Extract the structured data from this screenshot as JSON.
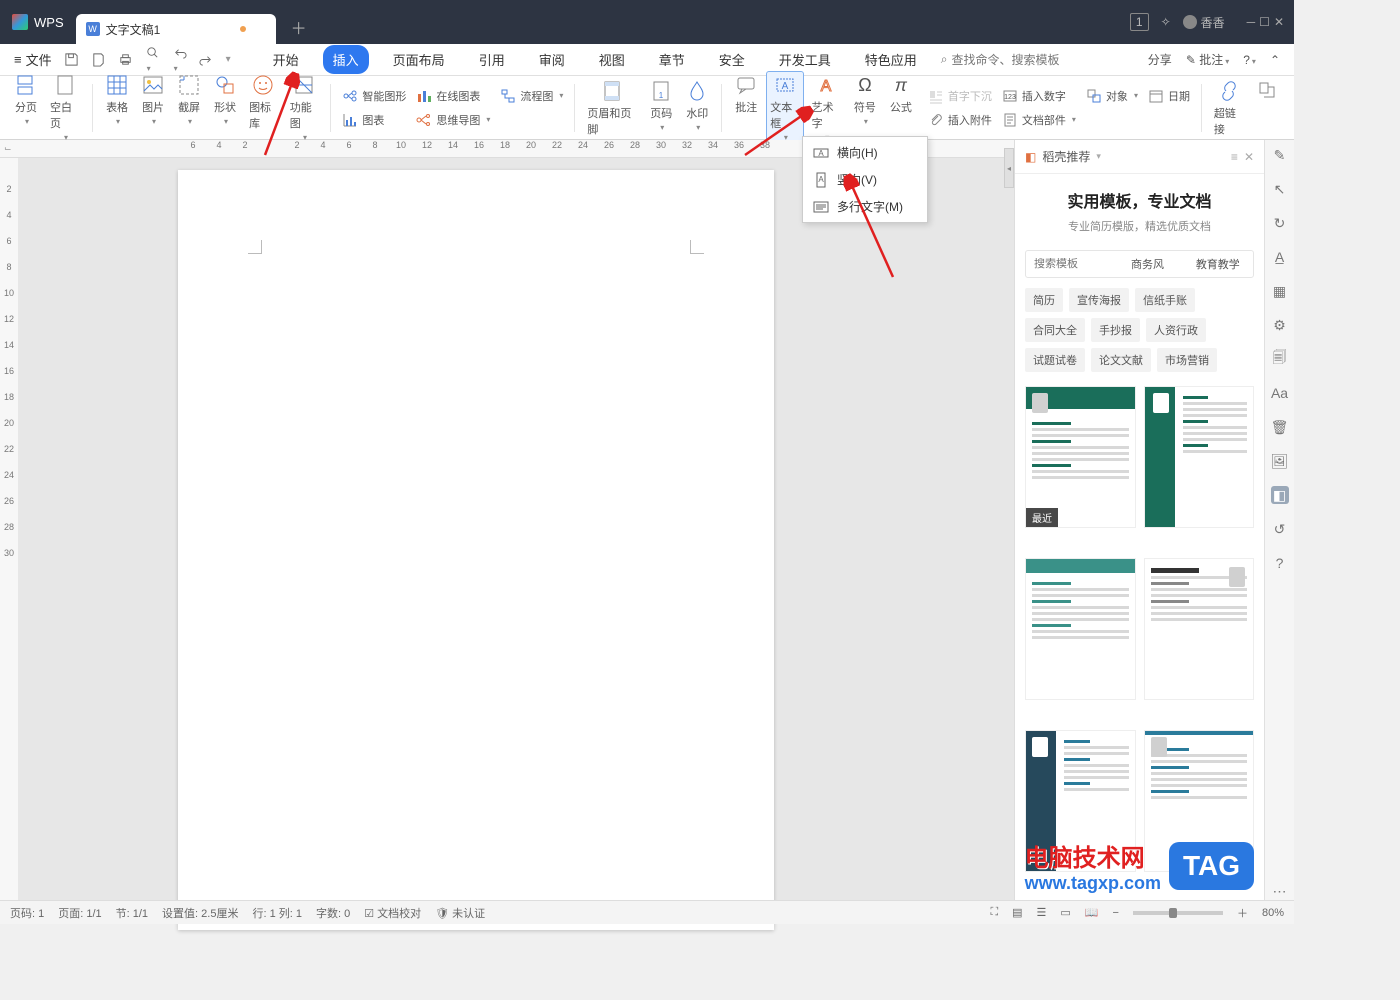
{
  "titlebar": {
    "app": "WPS",
    "tab_label": "文字文稿1",
    "user": "香香",
    "badge": "1"
  },
  "file_label": "文件",
  "menu_tabs": [
    "开始",
    "插入",
    "页面布局",
    "引用",
    "审阅",
    "视图",
    "章节",
    "安全",
    "开发工具",
    "特色应用"
  ],
  "menu_active_index": 1,
  "search_cmd": "查找命令、搜索模板",
  "menubar_right": {
    "share": "分享",
    "review": "批注"
  },
  "ribbon": {
    "section": "分页",
    "blank": "空白页",
    "table": "表格",
    "picture": "图片",
    "screenshot": "截屏",
    "shape": "形状",
    "iconlib": "图标库",
    "fnchart": "功能图",
    "smart": "智能图形",
    "onlinechart": "在线图表",
    "flow": "流程图",
    "chart": "图表",
    "mindmap": "思维导图",
    "headerfooter": "页眉和页脚",
    "pagenum": "页码",
    "watermark": "水印",
    "comment": "批注",
    "textbox": "文本框",
    "wordart": "艺术字",
    "symbol": "符号",
    "formula": "公式",
    "dropcap": "首字下沉",
    "number": "插入数字",
    "attach": "插入附件",
    "object": "对象",
    "date": "日期",
    "docpart": "文档部件",
    "hyperlink": "超链接"
  },
  "textbox_menu": {
    "h": "横向(H)",
    "v": "竖向(V)",
    "m": "多行文字(M)"
  },
  "hruler_ticks": [
    "6",
    "4",
    "2",
    "",
    "2",
    "4",
    "6",
    "8",
    "10",
    "12",
    "14",
    "16",
    "18",
    "20",
    "22",
    "24",
    "26",
    "28",
    "30",
    "32",
    "34",
    "36",
    "38"
  ],
  "vruler_ticks": [
    "",
    "2",
    "4",
    "6",
    "8",
    "10",
    "12",
    "14",
    "16",
    "18",
    "20",
    "22",
    "24",
    "26",
    "28",
    "30"
  ],
  "rightpanel": {
    "title": "稻壳推荐",
    "hero_title": "实用模板，专业文档",
    "hero_sub": "专业简历模版，精选优质文档",
    "search_placeholder": "搜索模板",
    "tabs": [
      "商务风",
      "教育教学"
    ],
    "tags": [
      "简历",
      "宣传海报",
      "信纸手账",
      "合同大全",
      "手抄报",
      "人资行政",
      "试题试卷",
      "论文文献",
      "市场营销"
    ],
    "recent_badge": "最近"
  },
  "status": {
    "page_no": "页码: 1",
    "page": "页面: 1/1",
    "sec": "节: 1/1",
    "setval": "设置值: 2.5厘米",
    "row": "行: 1  列: 1",
    "words": "字数: 0",
    "proof": "文档校对",
    "auth": "未认证",
    "zoom": "80%"
  },
  "watermark": {
    "text": "电脑技术网",
    "url": "www.tagxp.com",
    "tag": "TAG"
  }
}
